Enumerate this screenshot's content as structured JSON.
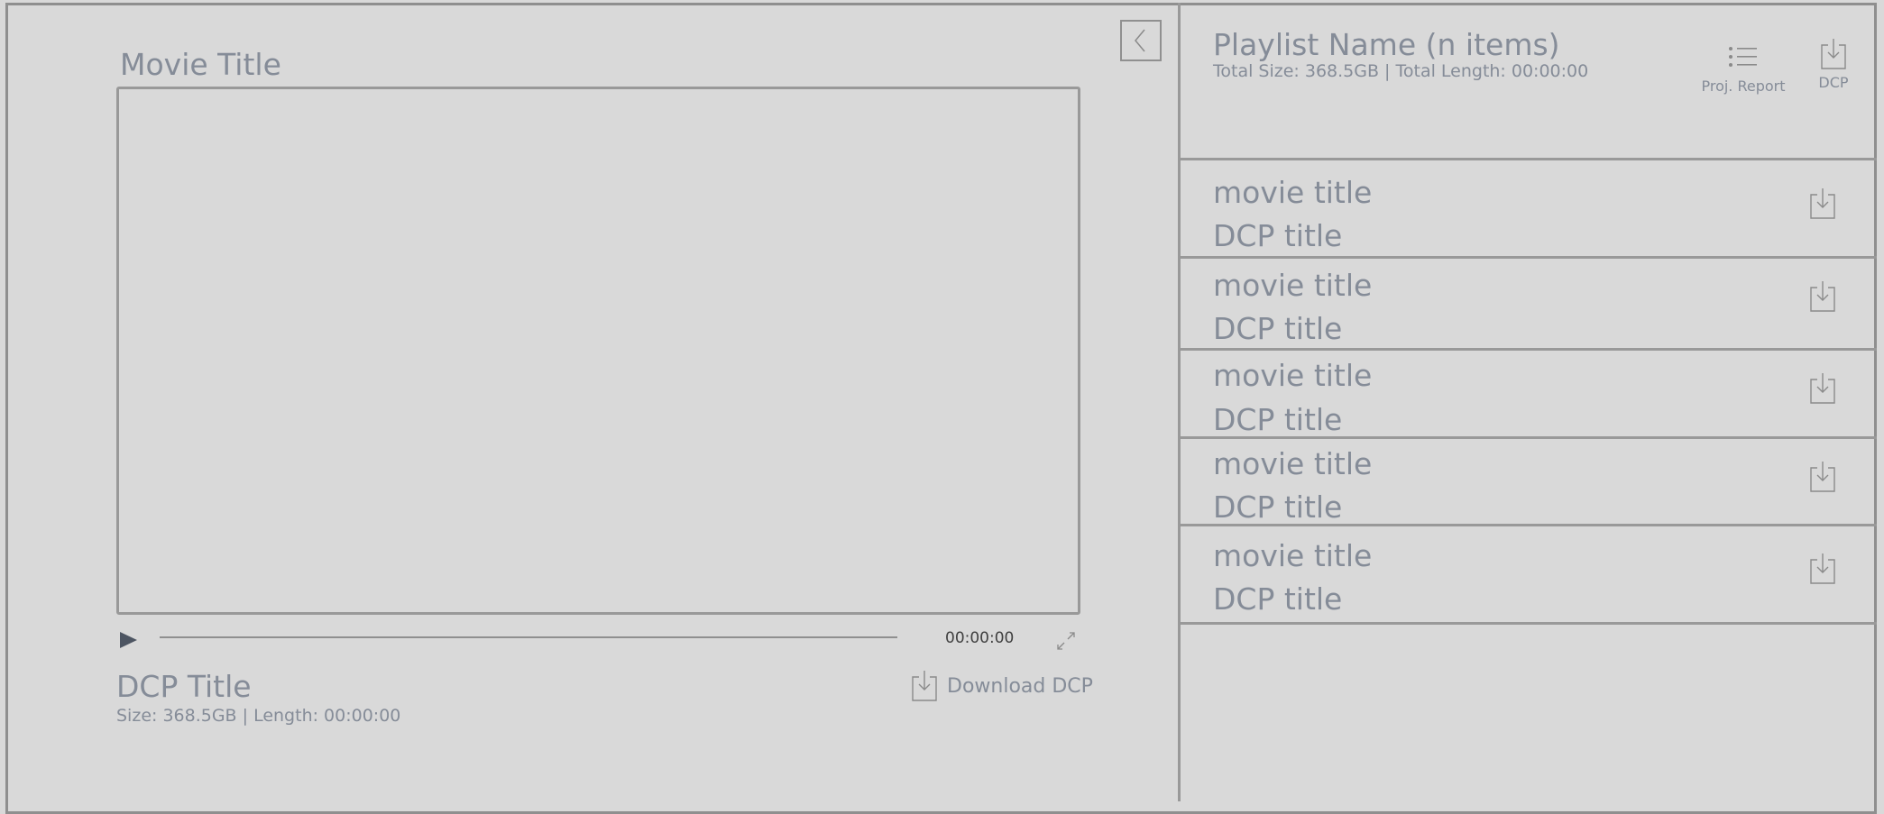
{
  "player": {
    "movie_title": "Movie Title",
    "time": "00:00:00",
    "dcp_title": "DCP Title",
    "dcp_meta": "Size: 368.5GB  |  Length: 00:00:00",
    "download_label": "Download DCP"
  },
  "playlist": {
    "name": "Playlist Name (n items)",
    "meta": "Total Size: 368.5GB  |  Total Length: 00:00:00",
    "report_label": "Proj. Report",
    "dcp_label": "DCP",
    "items": [
      {
        "movie": "movie title",
        "dcp": "DCP title"
      },
      {
        "movie": "movie title",
        "dcp": "DCP title"
      },
      {
        "movie": "movie title",
        "dcp": "DCP title"
      },
      {
        "movie": "movie title",
        "dcp": "DCP title"
      },
      {
        "movie": "movie title",
        "dcp": "DCP title"
      }
    ]
  },
  "icons": {
    "collapse": "chevron-left-icon",
    "play": "play-icon",
    "fullscreen": "expand-icon",
    "download": "download-icon",
    "report": "list-icon"
  }
}
